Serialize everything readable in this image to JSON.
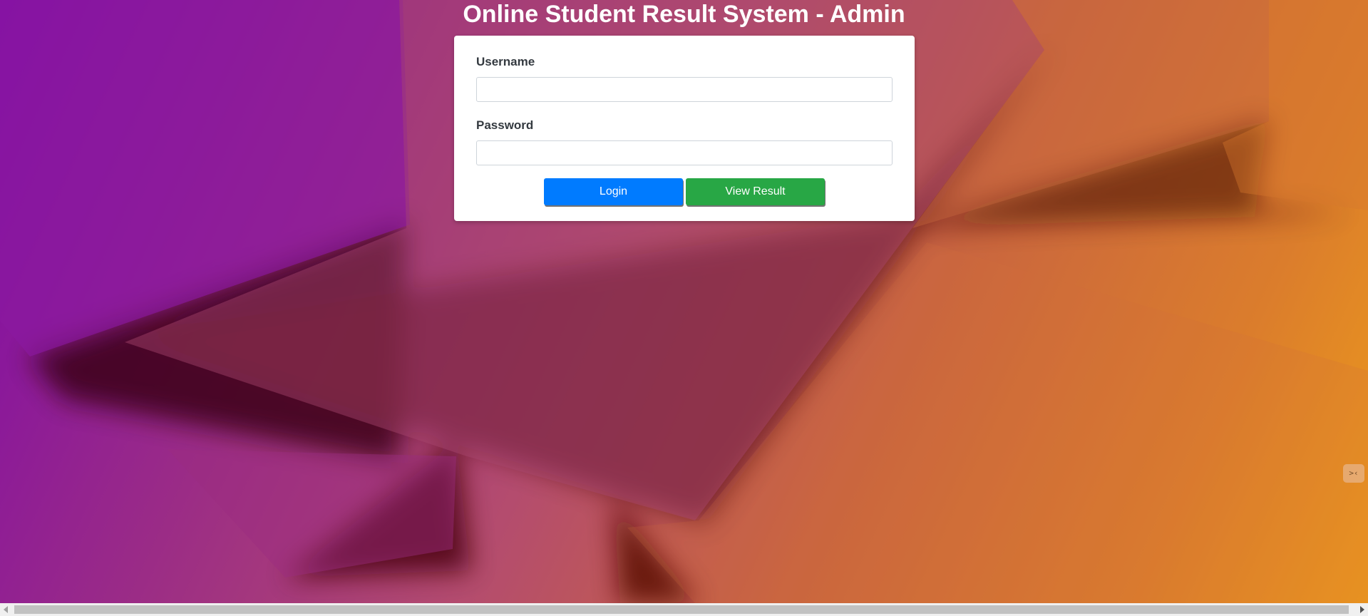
{
  "page": {
    "title": "Online Student Result System - Admin"
  },
  "login_form": {
    "username_label": "Username",
    "username_value": "",
    "password_label": "Password",
    "password_value": "",
    "login_button": "Login",
    "view_result_button": "View Result"
  },
  "colors": {
    "login_button": "#007bff",
    "view_result_button": "#28a745",
    "background_start": "#7e0aa9",
    "background_end": "#ee9c1a"
  },
  "side_widget": {
    "icon": "translate-icon",
    "glyph": ">‹"
  },
  "scrollbar": {
    "left_arrow_icon": "scroll-left-icon",
    "right_arrow_icon": "scroll-right-icon"
  }
}
